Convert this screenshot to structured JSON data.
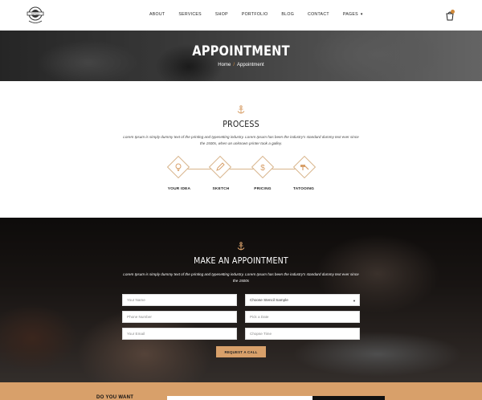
{
  "header": {
    "logo_name": "tattoo-logo",
    "nav": [
      {
        "label": "ABOUT"
      },
      {
        "label": "SERVICES"
      },
      {
        "label": "SHOP"
      },
      {
        "label": "PORTFOLIO"
      },
      {
        "label": "BLOG"
      },
      {
        "label": "CONTACT"
      },
      {
        "label": "PAGES"
      }
    ],
    "cart_icon": "cart-icon"
  },
  "banner": {
    "title": "APPOINTMENT",
    "breadcrumb": {
      "home": "Home",
      "sep": "/",
      "current": "Appointment"
    }
  },
  "process": {
    "title": "PROCESS",
    "text": "Lorem Ipsum is simply dummy text of the printing and typesetting industry. Lorem Ipsum has been the industry's standard dummy text ever since the 1500s, when an unknown printer took a galley.",
    "steps": [
      {
        "label": "YOUR IDEA",
        "icon": "lightbulb-icon"
      },
      {
        "label": "SKETCH",
        "icon": "pencil-icon"
      },
      {
        "label": "PRICING",
        "icon": "dollar-icon"
      },
      {
        "label": "TATOOING",
        "icon": "tattoo-machine-icon"
      }
    ]
  },
  "appointment": {
    "title": "MAKE AN APPOINTMENT",
    "text": "Lorem Ipsum is simply dummy text of the printing and typesetting industry. Lorem Ipsum has been the industry's standard dummy text ever since the 1500s",
    "fields": {
      "name": "Your Name",
      "phone": "Phone Number",
      "email": "Your Email",
      "stencil": "Choose Stencil Sample",
      "date": "Pick a Date",
      "time": "Chopse Time"
    },
    "submit": "REQUEST A CALL"
  },
  "cta": {
    "text": "DO YOU WANT"
  },
  "colors": {
    "accent": "#d8a06a",
    "accent_line": "#d8b48a"
  }
}
